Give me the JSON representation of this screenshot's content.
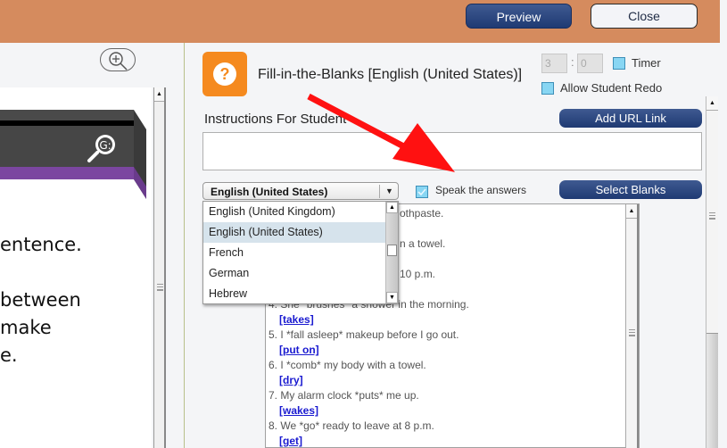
{
  "header": {
    "preview_label": "Preview",
    "close_label": "Close"
  },
  "slide_panel": {
    "zoom_button_icon": "zoom-in-icon",
    "banner_icon": "search-icon",
    "text_lines": [
      "entence.",
      " between",
      " make",
      "e."
    ]
  },
  "activity": {
    "icon": "question-icon",
    "icon_glyph": "?",
    "title": "Fill-in-the-Blanks [English (United States)]",
    "timer_minutes": "3",
    "timer_seconds": "0",
    "timer_colon": ":",
    "timer_label": "Timer",
    "timer_checked": false,
    "redo_label": "Allow Student Redo",
    "redo_checked": false,
    "instructions_label": "Instructions For Student",
    "instructions_value": "",
    "add_url_label": "Add URL Link",
    "select_blanks_label": "Select Blanks",
    "speak_label": "Speak the answers",
    "speak_checked": true,
    "accent_color": "#f58a1f",
    "button_color": "#1f3a73"
  },
  "language_select": {
    "selected": "English (United States)",
    "options": [
      "English (United Kingdom)",
      "English (United States)",
      "French",
      "German",
      "Hebrew"
    ]
  },
  "content": {
    "partial_lines": [
      "othpaste.",
      "n a towel.",
      "10 p.m."
    ],
    "items": [
      {
        "sentence": "4. She *brushes* a shower in the morning.",
        "answer": "[takes]"
      },
      {
        "sentence": "5. I *fall asleep* makeup before I go out.",
        "answer": "[put on]"
      },
      {
        "sentence": "6. I *comb* my body with a towel.",
        "answer": "[dry]"
      },
      {
        "sentence": "7. My alarm clock *puts* me up.",
        "answer": "[wakes]"
      },
      {
        "sentence": "8. We *go* ready to leave at 8 p.m.",
        "answer": "[get]"
      }
    ]
  },
  "annotation": {
    "type": "red-arrow",
    "points_to": "Speak the answers",
    "color": "#ff1111"
  }
}
